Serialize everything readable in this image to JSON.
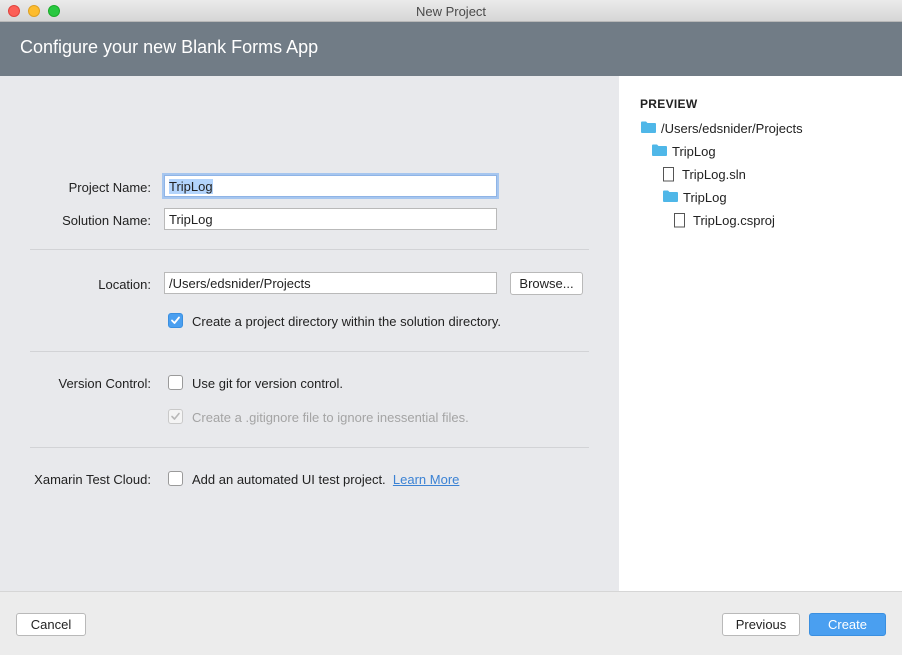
{
  "window": {
    "title": "New Project"
  },
  "header": {
    "title": "Configure your new Blank Forms App"
  },
  "form": {
    "project_name_label": "Project Name:",
    "project_name_value": "TripLog",
    "solution_name_label": "Solution Name:",
    "solution_name_value": "TripLog",
    "location_label": "Location:",
    "location_value": "/Users/edsnider/Projects",
    "browse_label": "Browse...",
    "create_dir_label": "Create a project directory within the solution directory.",
    "create_dir_checked": true,
    "version_control_label": "Version Control:",
    "use_git_label": "Use git for version control.",
    "use_git_checked": false,
    "gitignore_label": "Create a .gitignore file to ignore inessential files.",
    "gitignore_checked": true,
    "gitignore_enabled": false,
    "test_cloud_label": "Xamarin Test Cloud:",
    "ui_test_label": "Add an automated UI test project.",
    "ui_test_checked": false,
    "learn_more_label": "Learn More"
  },
  "preview": {
    "title": "PREVIEW",
    "tree": [
      {
        "type": "folder",
        "label": "/Users/edsnider/Projects",
        "depth": 0
      },
      {
        "type": "folder",
        "label": "TripLog",
        "depth": 1
      },
      {
        "type": "file",
        "label": "TripLog.sln",
        "depth": 2
      },
      {
        "type": "folder",
        "label": "TripLog",
        "depth": 2
      },
      {
        "type": "file",
        "label": "TripLog.csproj",
        "depth": 3
      }
    ]
  },
  "footer": {
    "cancel_label": "Cancel",
    "previous_label": "Previous",
    "create_label": "Create"
  },
  "colors": {
    "header_bg": "#717c86",
    "accent": "#4a9ff0",
    "folder_icon": "#4fb7e8",
    "link": "#3b82d4"
  }
}
